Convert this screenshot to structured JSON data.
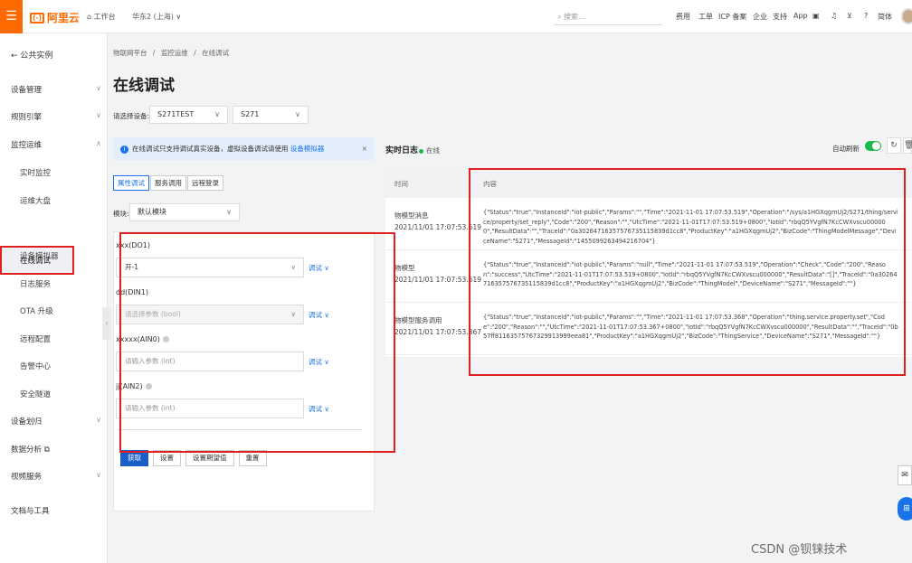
{
  "topbar": {
    "logo_text": "阿里云",
    "workbench": "工作台",
    "region": "华东2 (上海)",
    "search_placeholder": "搜索...",
    "links": [
      "费用",
      "工单",
      "ICP 备案",
      "企业",
      "支持",
      "App"
    ],
    "language": "简体"
  },
  "sidebar": {
    "back_label": "公共实例",
    "groups": [
      {
        "label": "设备管理"
      },
      {
        "label": "规则引擎"
      },
      {
        "label": "监控运维"
      },
      {
        "label": "设备划归"
      },
      {
        "label": "数据分析"
      },
      {
        "label": "视频服务"
      },
      {
        "label": "文档与工具"
      }
    ],
    "sub_items": [
      "实时监控",
      "运维大盘",
      "在线调试",
      "设备模拟器",
      "日志服务",
      "OTA 升级",
      "远程配置",
      "告警中心",
      "安全隧道"
    ],
    "active_item": "在线调试"
  },
  "breadcrumb": {
    "items": [
      "物联网平台",
      "监控运维",
      "在线调试"
    ],
    "separator": "/"
  },
  "page_title": "在线调试",
  "device_select": {
    "label": "请选择设备:",
    "product": "S271TEST",
    "device": "S271"
  },
  "notice": {
    "text": "在线调试只支持调试真实设备，虚拟设备调试请使用",
    "link": "设备模拟器",
    "close": "×"
  },
  "tabs": [
    "属性调试",
    "服务调用",
    "远程登录"
  ],
  "active_tab": "属性调试",
  "module": {
    "label": "模块:",
    "value": "默认模块"
  },
  "properties": [
    {
      "name": "xxx(DO1)",
      "value": "开-1",
      "placeholder": "",
      "disabled": false,
      "debug": "调试"
    },
    {
      "name": "dd(DIN1)",
      "value": "",
      "placeholder": "请选择参数 (bool)",
      "disabled": true,
      "debug": "调试"
    },
    {
      "name": "xxxxx(AIN0)",
      "value": "",
      "placeholder": "请输入参数 (int)",
      "disabled": false,
      "debug": "调试"
    },
    {
      "name": "jj(AIN2)",
      "value": "",
      "placeholder": "请输入参数 (int)",
      "disabled": false,
      "debug": "调试"
    }
  ],
  "buttons": {
    "get": "获取",
    "set": "设置",
    "set_expected": "设置期望值",
    "reset": "重置"
  },
  "log": {
    "title": "实时日志",
    "status": "在线",
    "auto_refresh": "自动刷新",
    "auto_refresh_on": true,
    "columns": [
      "时间",
      "内容"
    ],
    "rows": [
      {
        "type": "物模型消息",
        "time": "2021/11/01 17:07:53.519",
        "content": "{\"Status\":\"true\",\"InstanceId\":\"iot-public\",\"Params\":\"\",\"Time\":\"2021-11-01 17:07:53.519\",\"Operation\":\"/sys/a1HGXqgmUj2/S271/thing/service/property/set_reply\",\"Code\":\"200\",\"Reason\":\"\",\"UtcTime\":\"2021-11-01T17:07:53.519+0800\",\"IotId\":\"rbqQ5YVgfN7KcCWXvscu000000\",\"ResultData\":\"\",\"TraceId\":\"0a30264716357576735115839d1cc8\",\"ProductKey\":\"a1HGXqgmUj2\",\"BizCode\":\"ThingModelMessage\",\"DeviceName\":\"S271\",\"MessageId\":\"1455099263494216704\"}"
      },
      {
        "type": "物模型",
        "time": "2021/11/01 17:07:53.519",
        "content": "{\"Status\":\"true\",\"InstanceId\":\"iot-public\",\"Params\":\"null\",\"Time\":\"2021-11-01 17:07:53.519\",\"Operation\":\"Check\",\"Code\":\"200\",\"Reason\":\"success\",\"UtcTime\":\"2021-11-01T17:07:53.519+0800\",\"IotId\":\"rbqQ5YVgfN7KcCWXvscu000000\",\"ResultData\":\"[]\",\"TraceId\":\"0a30264716357576735115839d1cc8\",\"ProductKey\":\"a1HGXqgmUj2\",\"BizCode\":\"ThingModel\",\"DeviceName\":\"S271\",\"MessageId\":\"\"}"
      },
      {
        "type": "物模型服务调用",
        "time": "2021/11/01 17:07:53.367",
        "content": "{\"Status\":\"true\",\"InstanceId\":\"iot-public\",\"Params\":\"\",\"Time\":\"2021-11-01 17:07:53.368\",\"Operation\":\"thing.service.property.set\",\"Code\":\"200\",\"Reason\":\"\",\"UtcTime\":\"2021-11-01T17:07:53.367+0800\",\"IotId\":\"rbqQ5YVgfN7KcCWXvscu000000\",\"ResultData\":\"\",\"TraceId\":\"0b57ff81163575767329913999eea81\",\"ProductKey\":\"a1HGXqgmUj2\",\"BizCode\":\"ThingService\",\"DeviceName\":\"S271\",\"MessageId\":\"\"}"
      }
    ]
  },
  "watermark": "CSDN @钡铼技术",
  "colors": {
    "accent": "#ff6a00",
    "primary": "#1a5fc8",
    "link": "#1a73e8",
    "highlight": "#e02020",
    "online": "#1cb94d"
  }
}
